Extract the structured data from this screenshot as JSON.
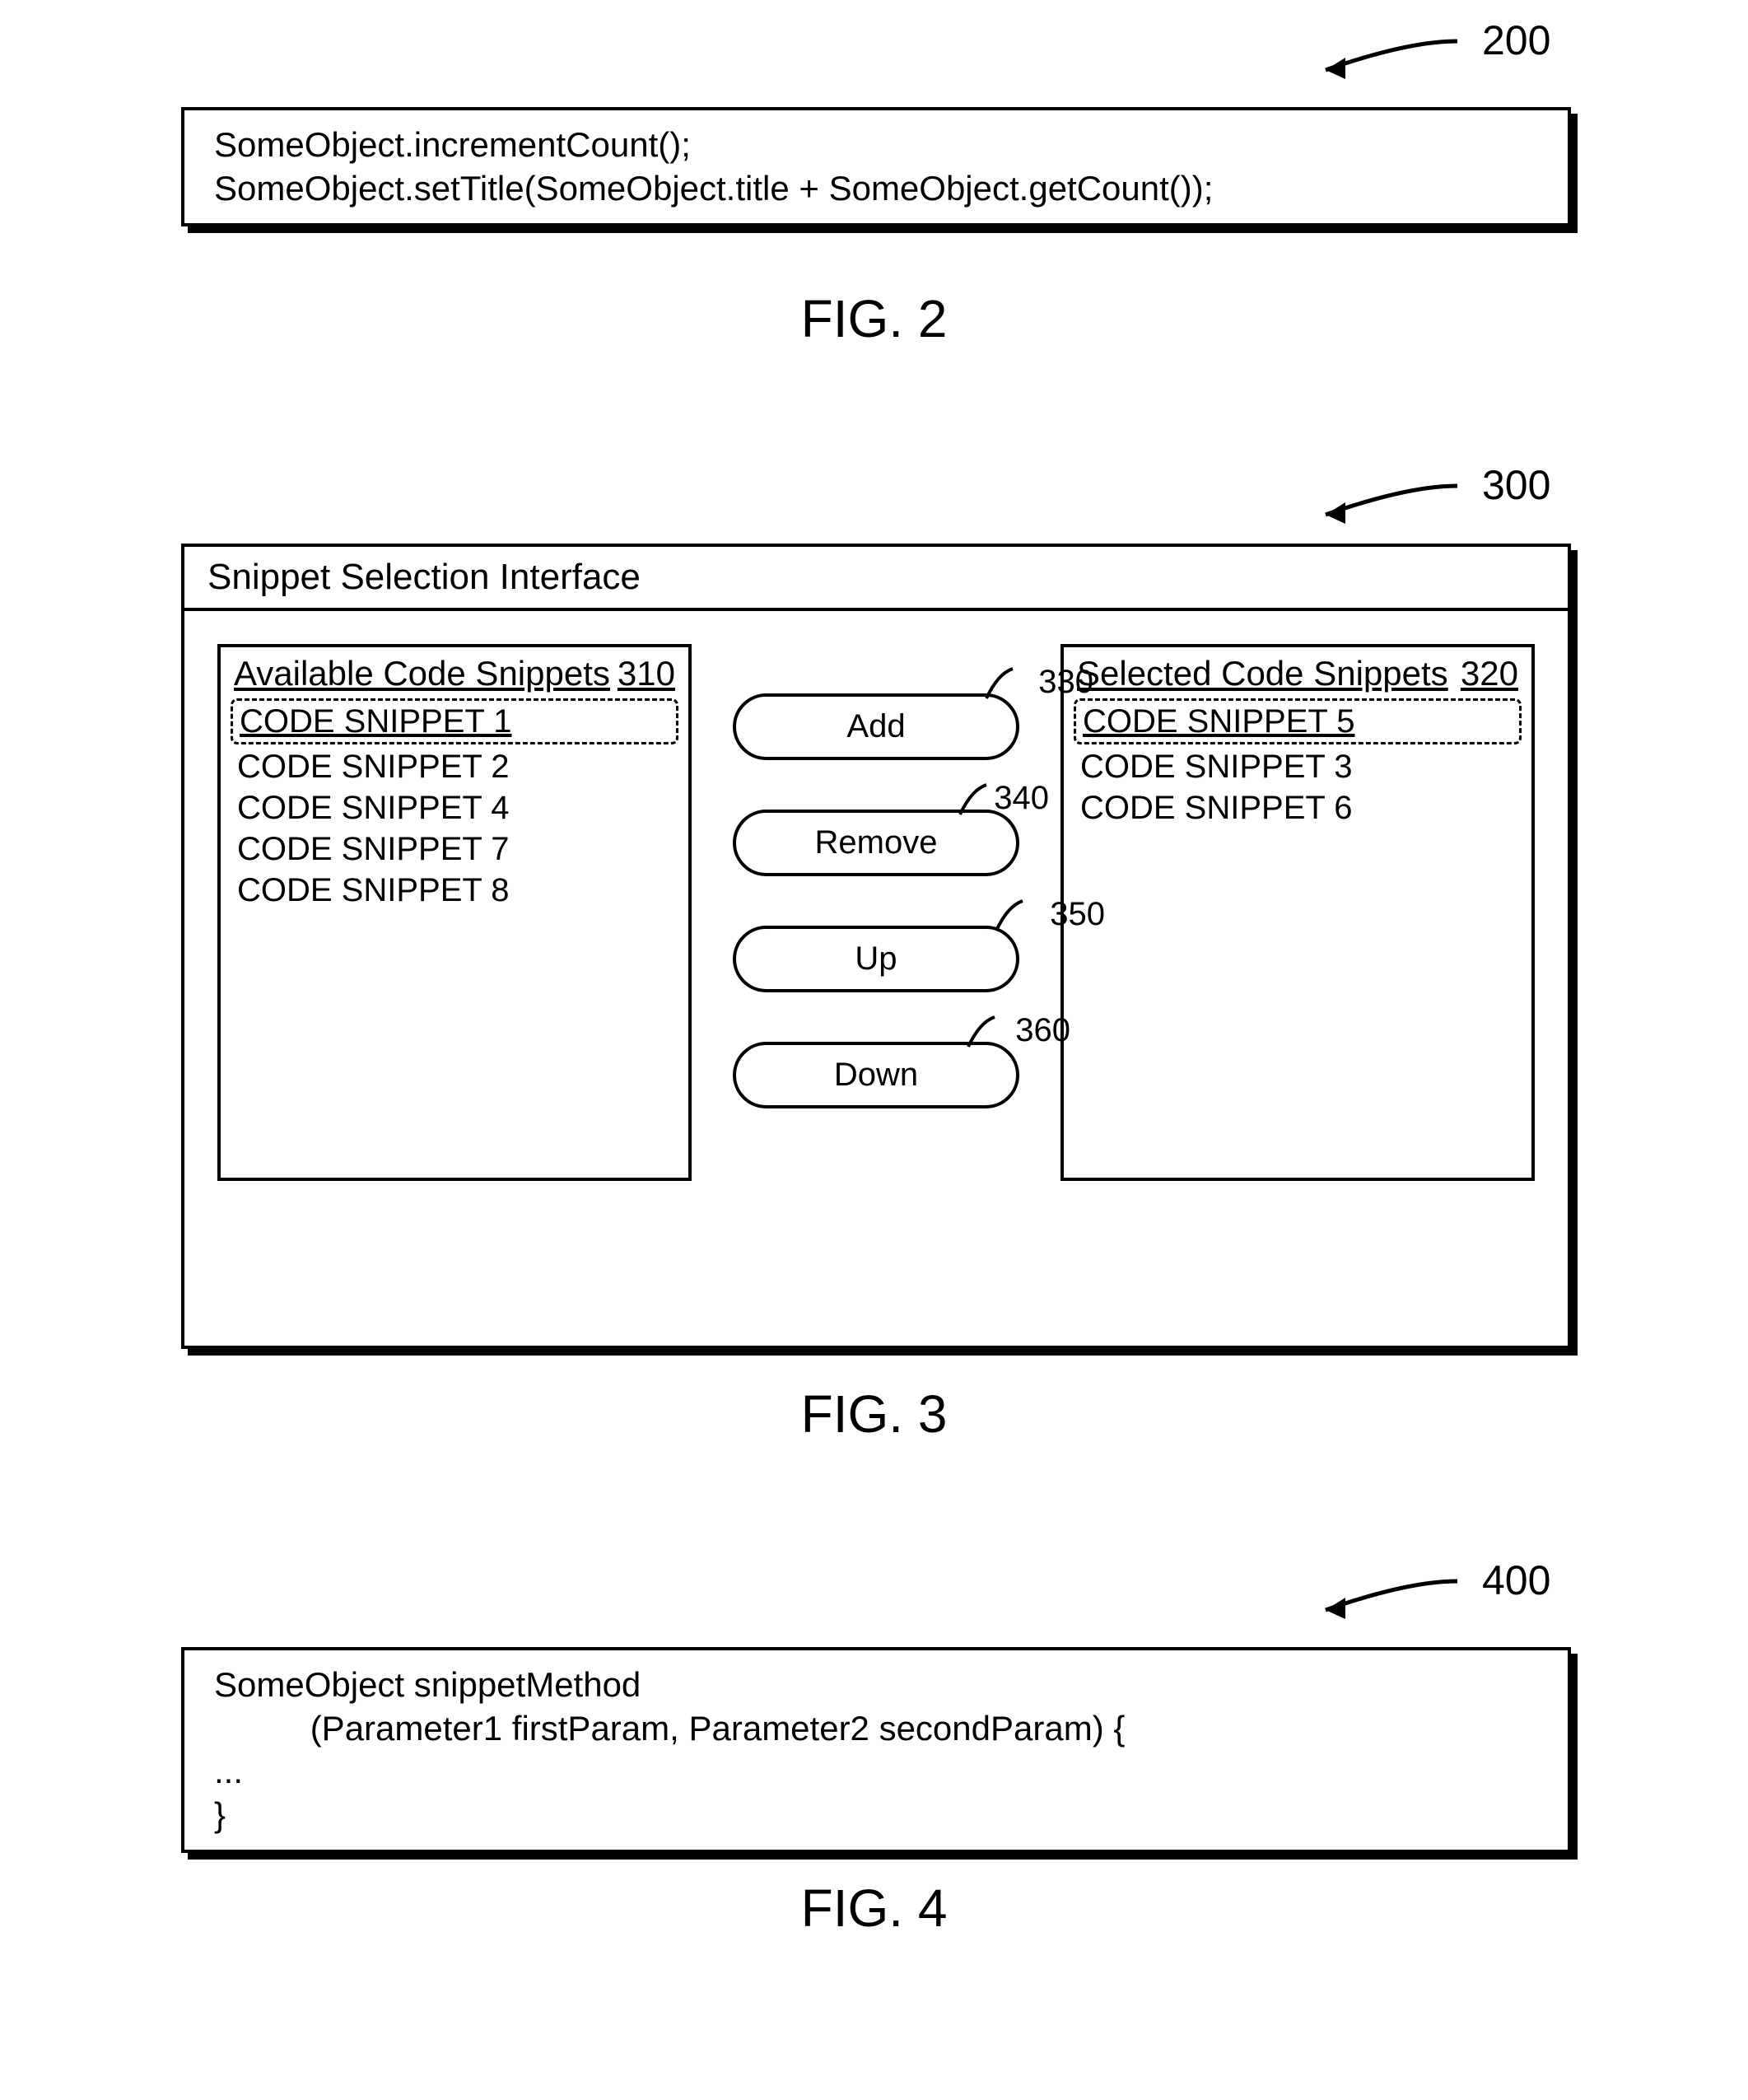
{
  "fig2": {
    "ref": "200",
    "code": "SomeObject.incrementCount();\nSomeObject.setTitle(SomeObject.title + SomeObject.getCount());",
    "caption": "FIG. 2"
  },
  "fig3": {
    "ref": "300",
    "window_title": "Snippet Selection Interface",
    "available": {
      "title": "Available Code Snippets",
      "panel_ref": "310",
      "items": [
        {
          "label": "CODE SNIPPET 1",
          "selected": true
        },
        {
          "label": "CODE SNIPPET 2",
          "selected": false
        },
        {
          "label": "CODE SNIPPET 4",
          "selected": false
        },
        {
          "label": "CODE SNIPPET 7",
          "selected": false
        },
        {
          "label": "CODE SNIPPET 8",
          "selected": false
        }
      ]
    },
    "selected": {
      "title": "Selected Code Snippets",
      "panel_ref": "320",
      "items": [
        {
          "label": "CODE SNIPPET 5",
          "selected": true
        },
        {
          "label": "CODE SNIPPET 3",
          "selected": false
        },
        {
          "label": "CODE SNIPPET 6",
          "selected": false
        }
      ]
    },
    "buttons": {
      "add": {
        "label": "Add",
        "ref": "330"
      },
      "remove": {
        "label": "Remove",
        "ref": "340"
      },
      "up": {
        "label": "Up",
        "ref": "350"
      },
      "down": {
        "label": "Down",
        "ref": "360"
      }
    },
    "caption": "FIG. 3"
  },
  "fig4": {
    "ref": "400",
    "code": "SomeObject snippetMethod\n          (Parameter1 firstParam, Parameter2 secondParam) {\n...\n}",
    "caption": "FIG. 4"
  }
}
